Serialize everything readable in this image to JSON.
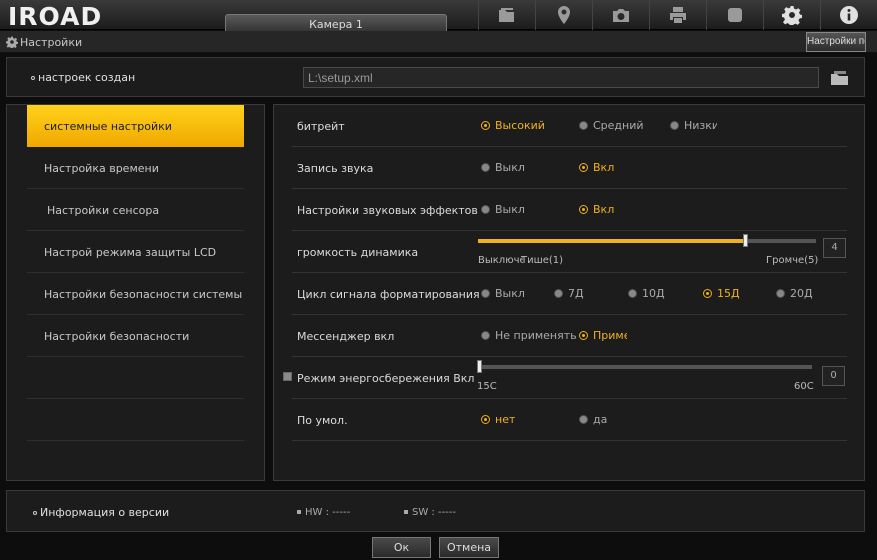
{
  "app": {
    "logo": "IROAD",
    "camera_tab": "Камера 1"
  },
  "titlebar": {
    "title": "Настройки",
    "default_button": "Настройки по умол."
  },
  "setup": {
    "label": "настроек создан",
    "path": "L:\\setup.xml"
  },
  "menu": [
    {
      "label": "системные настройки",
      "active": true
    },
    {
      "label": "Настройка времени",
      "active": false
    },
    {
      "label": "Настройки сенсора",
      "active": false
    },
    {
      "label": "Настрой режима защиты LCD",
      "active": false
    },
    {
      "label": "Настройки безопасности системы",
      "active": false
    },
    {
      "label": "Настройки безопасности",
      "active": false
    }
  ],
  "settings": {
    "bitrate": {
      "label": "битрейт",
      "options": [
        "Высокий",
        "Средний",
        "Низкий"
      ],
      "selected": 0
    },
    "audio": {
      "label": "Запись звука",
      "options": [
        "Выкл",
        "Вкл"
      ],
      "selected": 1
    },
    "sound_fx": {
      "label": "Настройки звуковых эффектов",
      "options": [
        "Выкл",
        "Вкл"
      ],
      "selected": 1
    },
    "volume": {
      "label": "громкость динамика",
      "label_off": "Выключен",
      "label_quiet": "Тише(1)",
      "label_loud": "Громче(5)",
      "value": "4"
    },
    "format_cycle": {
      "label": "Цикл сигнала форматирования SD-карты",
      "options": [
        "Выкл",
        "7Д",
        "10Д",
        "15Д",
        "20Д"
      ],
      "selected": 3
    },
    "messenger": {
      "label": "Мессенджер вкл",
      "options": [
        "Не применять",
        "Применять"
      ],
      "selected": 1
    },
    "power_save": {
      "label": "Режим энергосбережения Вкл",
      "min_label": "15С",
      "max_label": "60С",
      "value": "0"
    },
    "default": {
      "label": "По умол.",
      "options": [
        "нет",
        "да"
      ],
      "selected": 0
    }
  },
  "version": {
    "label": "Информация о версии",
    "hw": "HW : -----",
    "sw": "SW : -----"
  },
  "buttons": {
    "ok": "Ок",
    "cancel": "Отмена"
  },
  "colors": {
    "accent": "#f0b020",
    "menu_active": "#ffc400"
  }
}
